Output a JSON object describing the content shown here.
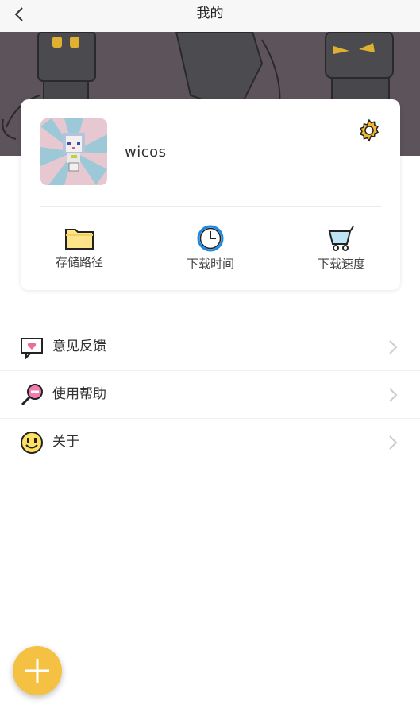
{
  "header": {
    "title": "我的"
  },
  "profile": {
    "username": "wicos"
  },
  "shortcuts": [
    {
      "label": "存储路径",
      "icon": "folder-icon"
    },
    {
      "label": "下载时间",
      "icon": "clock-icon"
    },
    {
      "label": "下载速度",
      "icon": "cart-icon"
    }
  ],
  "menu": [
    {
      "label": "意见反馈",
      "icon": "feedback-icon"
    },
    {
      "label": "使用帮助",
      "icon": "help-lollipop-icon"
    },
    {
      "label": "关于",
      "icon": "smiley-icon"
    }
  ],
  "colors": {
    "fab": "#f5c143",
    "banner": "#5a5058",
    "folder": "#ffe58a",
    "clock": "#1e88e5"
  }
}
